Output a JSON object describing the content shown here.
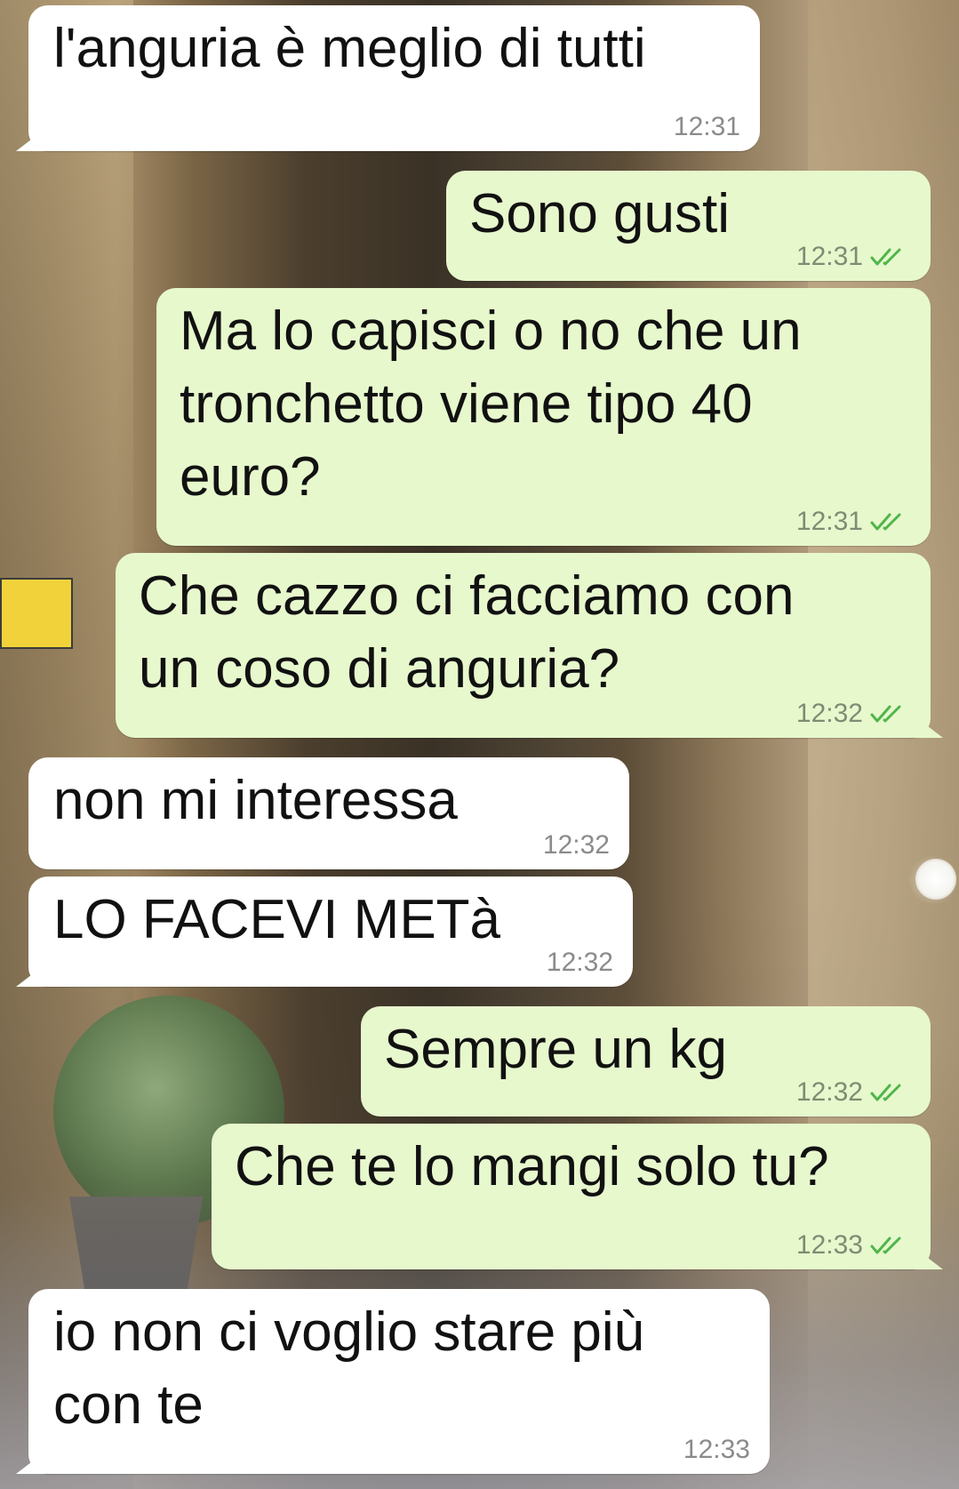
{
  "colors": {
    "incoming_bubble": "#ffffff",
    "outgoing_bubble": "#e7f8cd",
    "read_ticks": "#4fb649",
    "timestamp": "#8b8b8b"
  },
  "messages": [
    {
      "direction": "in",
      "text": "l'anguria è meglio di tutti",
      "time": "12:31"
    },
    {
      "direction": "out",
      "text": "Sono gusti",
      "time": "12:31",
      "status_icon": "double-check-icon"
    },
    {
      "direction": "out",
      "text": "Ma lo capisci o no che un\ntronchetto viene tipo 40\neuro?",
      "time": "12:31",
      "status_icon": "double-check-icon"
    },
    {
      "direction": "out",
      "text": "Che cazzo ci facciamo con\nun coso di anguria?",
      "time": "12:32",
      "status_icon": "double-check-icon"
    },
    {
      "direction": "in",
      "text": "non mi interessa",
      "time": "12:32"
    },
    {
      "direction": "in",
      "text": "LO FACEVI METà",
      "time": "12:32"
    },
    {
      "direction": "out",
      "text": "Sempre un kg",
      "time": "12:32",
      "status_icon": "double-check-icon"
    },
    {
      "direction": "out",
      "text": "Che te lo mangi solo tu?",
      "time": "12:33",
      "status_icon": "double-check-icon"
    },
    {
      "direction": "in",
      "text": "io non ci voglio stare più\ncon te",
      "time": "12:33"
    }
  ]
}
